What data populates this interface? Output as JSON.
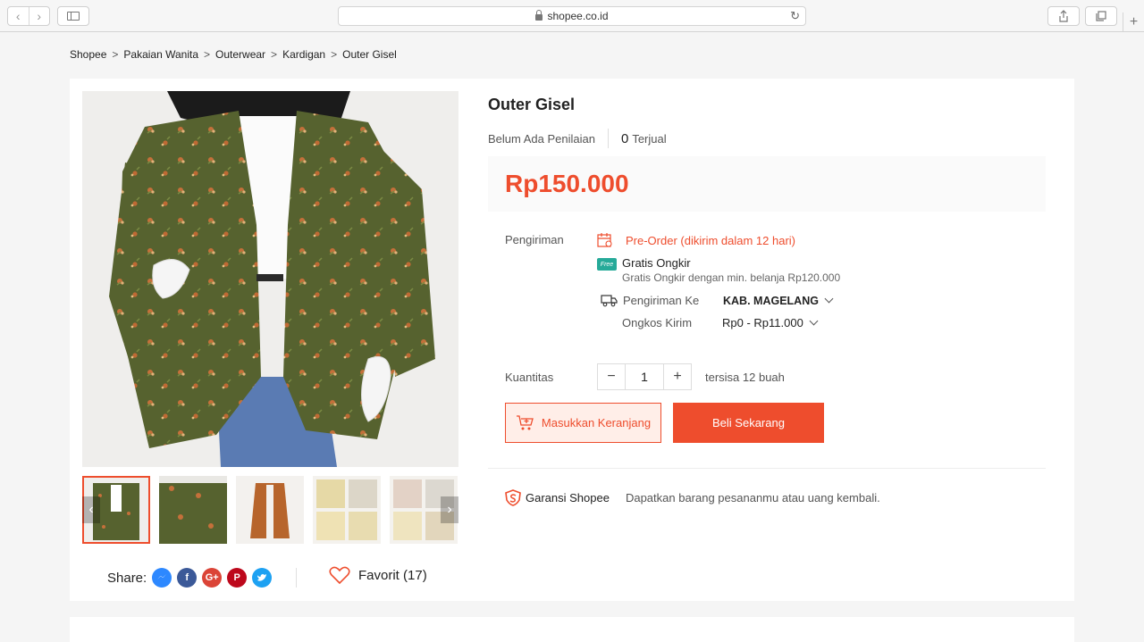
{
  "browser": {
    "url": "shopee.co.id"
  },
  "breadcrumb": [
    "Shopee",
    "Pakaian Wanita",
    "Outerwear",
    "Kardigan",
    "Outer Gisel"
  ],
  "product": {
    "title": "Outer Gisel",
    "rating_text": "Belum Ada Penilaian",
    "sold_count": "0",
    "sold_label": "Terjual",
    "price": "Rp150.000"
  },
  "shipping": {
    "label": "Pengiriman",
    "preorder": "Pre-Order (dikirim dalam 12 hari)",
    "free_badge": "Free",
    "free_title": "Gratis Ongkir",
    "free_sub": "Gratis Ongkir dengan min. belanja Rp120.000",
    "ship_to_label": "Pengiriman Ke",
    "ship_to_value": "KAB. MAGELANG",
    "cost_label": "Ongkos Kirim",
    "cost_value": "Rp0 - Rp11.000"
  },
  "quantity": {
    "label": "Kuantitas",
    "value": "1",
    "stock": "tersisa 12 buah"
  },
  "actions": {
    "cart_label": "Masukkan Keranjang",
    "buy_label": "Beli Sekarang"
  },
  "guarantee": {
    "title": "Garansi Shopee",
    "desc": "Dapatkan barang pesananmu atau uang kembali."
  },
  "share": {
    "label": "Share:",
    "icons": [
      "messenger-icon",
      "facebook-icon",
      "google-plus-icon",
      "pinterest-icon",
      "twitter-icon"
    ],
    "favorite": "Favorit (17)"
  },
  "colors": {
    "accent": "#ee4d2d",
    "free_shipping": "#26aa99"
  }
}
